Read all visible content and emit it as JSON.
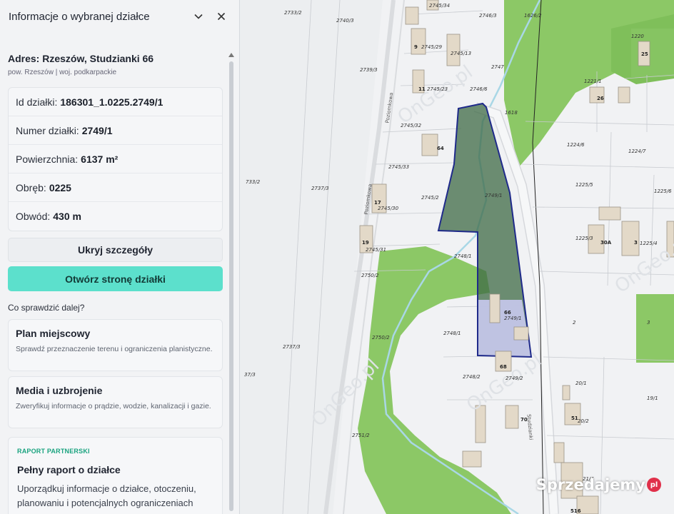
{
  "panel": {
    "title": "Informacje o wybranej działce",
    "address_title": "Adres: Rzeszów, Studzianki 66",
    "address_sub": "pow. Rzeszów | woj. podkarpackie",
    "details": [
      {
        "label": "Id działki:",
        "value": "186301_1.0225.2749/1"
      },
      {
        "label": "Numer działki:",
        "value": "2749/1"
      },
      {
        "label": "Powierzchnia:",
        "value": "6137 m²"
      },
      {
        "label": "Obręb:",
        "value": "0225"
      },
      {
        "label": "Obwód:",
        "value": "430 m"
      }
    ],
    "hide_button": "Ukryj szczegóły",
    "open_button": "Otwórz stronę działki",
    "next_label": "Co sprawdzić dalej?",
    "cards": [
      {
        "title": "Plan miejscowy",
        "desc": "Sprawdź przeznaczenie terenu i ograniczenia planistyczne."
      },
      {
        "title": "Media i uzbrojenie",
        "desc": "Zweryfikuj informacje o prądzie, wodzie, kanalizacji i gazie."
      }
    ],
    "partner": {
      "tag": "RAPORT PARTNERSKI",
      "title": "Pełny raport o działce",
      "desc": "Uporządkuj informacje o działce, otoczeniu, planowaniu i potencjalnych ograniczeniach"
    }
  },
  "map": {
    "parcel_labels": [
      "2733/2",
      "2740/3",
      "2745/34",
      "2746/3",
      "1626/2",
      "1220",
      "25",
      "9",
      "2745/29",
      "2745/13",
      "2747",
      "2739/3",
      "11",
      "2745/23",
      "2746/6",
      "1221/1",
      "26",
      "2745/32",
      "64",
      "1618",
      "1224/6",
      "1224/7",
      "2745/33",
      "2749/1",
      "1225/5",
      "1225/6",
      "733/2",
      "2737/3",
      "17",
      "2745/30",
      "2745/2",
      "1225/3",
      "30A",
      "3",
      "1225/4",
      "19",
      "2745/31",
      "2748/1",
      "2750/2",
      "66",
      "2749/1",
      "2",
      "3",
      "2748/1",
      "2750/2",
      "2737/3",
      "68",
      "2748/2",
      "2749/2",
      "20/1",
      "19/1",
      "70",
      "51",
      "20/2",
      "2751/2",
      "21/4",
      "516",
      "37/3"
    ],
    "street_labels": [
      "Poziomkowa",
      "Poziomkowa",
      "Studzianki"
    ],
    "watermarks": [
      "OnGeo.pl",
      "OnGeo.pl",
      "OnGeo.pl",
      "OnGeo.pl"
    ],
    "brand": "Sprzedajemy",
    "brand_suffix": "pl",
    "colors": {
      "green": "#8cc866",
      "parcel_fill": "#3e6a45",
      "parcel_border": "#1f2a8a",
      "accent": "#5ce0cc"
    }
  }
}
